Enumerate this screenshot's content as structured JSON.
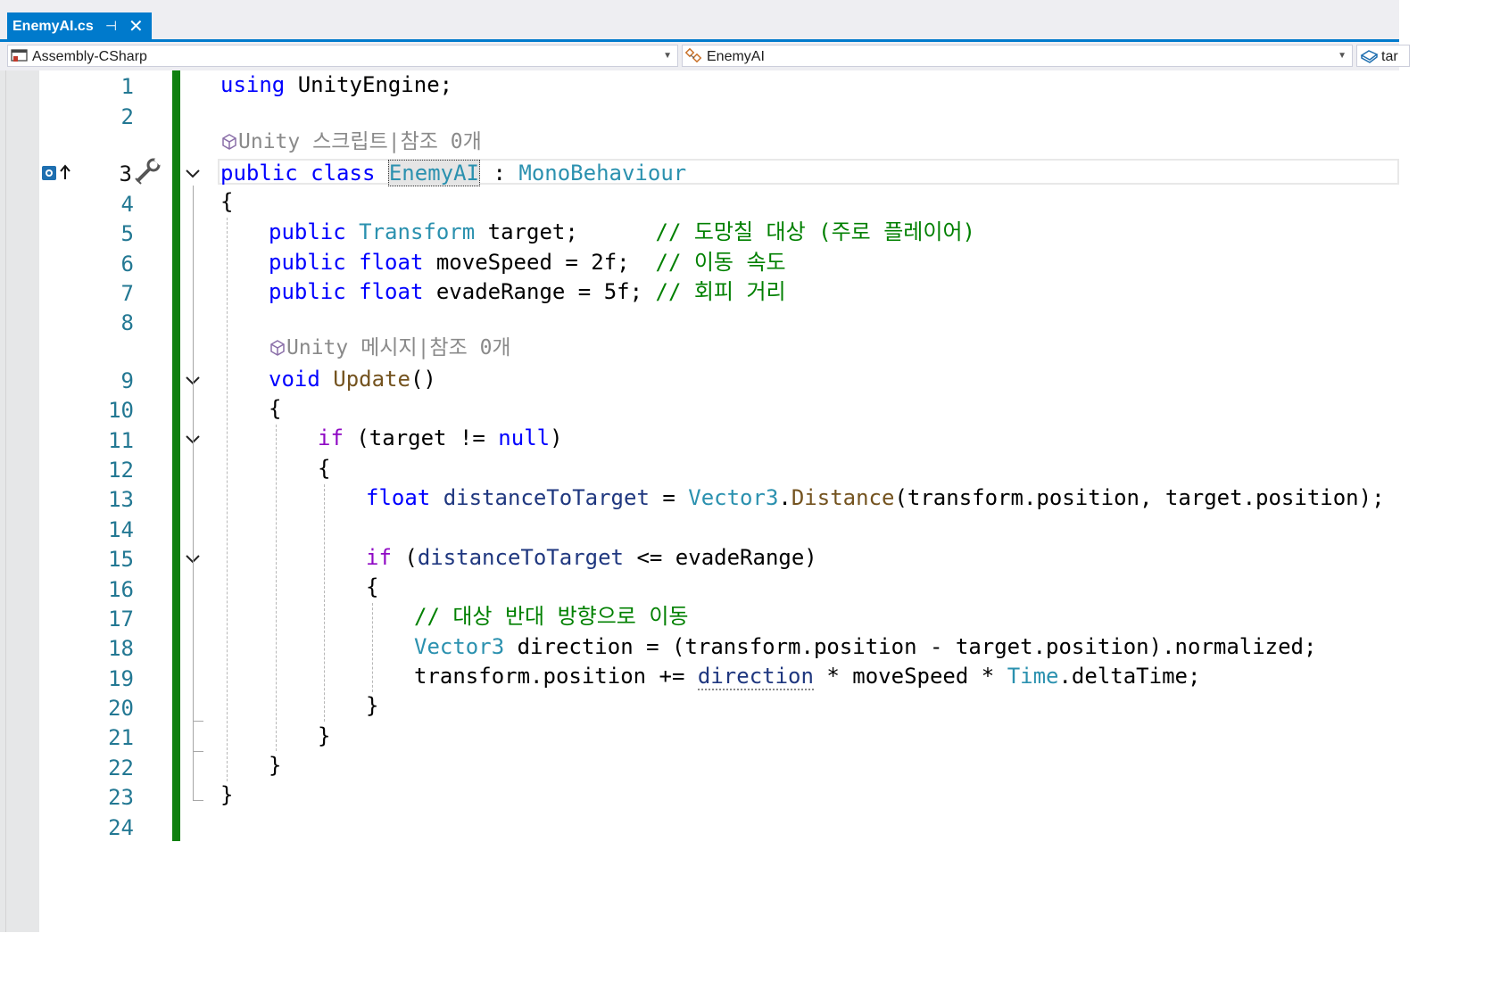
{
  "tab": {
    "filename": "EnemyAI.cs",
    "pin": "⊣",
    "close": "✕"
  },
  "navbar": {
    "project": "Assembly-CSharp",
    "type": "EnemyAI",
    "member": "tar"
  },
  "codelens": {
    "class_lens": "Unity 스크립트|참조 0개",
    "method_lens": "Unity 메시지|참조 0개"
  },
  "line_numbers": [
    "1",
    "2",
    "3",
    "4",
    "5",
    "6",
    "7",
    "8",
    "9",
    "10",
    "11",
    "12",
    "13",
    "14",
    "15",
    "16",
    "17",
    "18",
    "19",
    "20",
    "21",
    "22",
    "23",
    "24"
  ],
  "code": {
    "l1": {
      "kw": "using",
      "rest": " UnityEngine;"
    },
    "l3": {
      "kw1": "public",
      "kw2": "class",
      "cls": "EnemyAI",
      "colon": " : ",
      "base": "MonoBehaviour"
    },
    "l4": "{",
    "l5": {
      "kw": "public",
      "ty": "Transform",
      "rest": " target;      ",
      "cm": "// 도망칠 대상 (주로 플레이어)"
    },
    "l6": {
      "kw1": "public",
      "kw2": "float",
      "rest": " moveSpeed = 2f;  ",
      "cm": "// 이동 속도"
    },
    "l7": {
      "kw1": "public",
      "kw2": "float",
      "rest": " evadeRange = 5f; ",
      "cm": "// 회피 거리"
    },
    "l9": {
      "kw": "void",
      "fn": "Update",
      "rest": "()"
    },
    "l10": "{",
    "l11": {
      "ctl": "if",
      "rest1": " (target != ",
      "kw": "null",
      "rest2": ")"
    },
    "l12": "{",
    "l13": {
      "kw": "float",
      "var": "distanceToTarget",
      "eq": " = ",
      "ty": "Vector3",
      "dot": ".",
      "fn": "Distance",
      "rest": "(transform.position, target.position);"
    },
    "l15": {
      "ctl": "if",
      "open": " (",
      "var": "distanceToTarget",
      "rest": " <= evadeRange)"
    },
    "l16": "{",
    "l17": {
      "cm": "// 대상 반대 방향으로 이동"
    },
    "l18": {
      "ty": "Vector3",
      "rest": " direction = (transform.position - target.position).normalized;"
    },
    "l19": {
      "pre": "transform.position += ",
      "var": "direction",
      "mid": " * moveSpeed * ",
      "ty": "Time",
      "rest": ".deltaTime;"
    },
    "l20": "}",
    "l21": "}",
    "l22": "}",
    "l23": "}"
  },
  "colors": {
    "accent": "#007acc",
    "change_bar": "#108010",
    "keyword": "#0000ff",
    "type": "#2b91af",
    "comment": "#008000"
  },
  "icons": [
    "pin-icon",
    "close-icon",
    "project-icon",
    "class-icon",
    "field-icon",
    "unity-icon",
    "breakpoint-icon",
    "quick-action-icon",
    "chevron-down-icon"
  ]
}
